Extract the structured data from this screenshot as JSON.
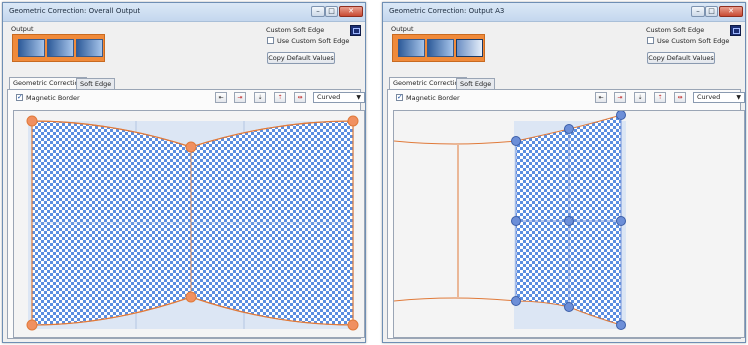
{
  "windows": [
    {
      "title": "Geometric Correction: Overall Output",
      "output_label": "Output",
      "custom_soft_edge_label": "Custom Soft Edge",
      "use_custom_soft_edge_label": "Use Custom Soft Edge",
      "copy_default_values_label": "Copy Default Values",
      "tabs": [
        "Geometric Correction",
        "Soft Edge"
      ],
      "magnetic_border_label": "Magnetic Border",
      "magnetic_border_checked": true,
      "mode_value": "Curved",
      "mode_arrow": "▼",
      "selected_output": null
    },
    {
      "title": "Geometric Correction: Output A3",
      "output_label": "Output",
      "custom_soft_edge_label": "Custom Soft Edge",
      "use_custom_soft_edge_label": "Use Custom Soft Edge",
      "copy_default_values_label": "Copy Default Values",
      "tabs": [
        "Geometric Correction",
        "Soft Edge"
      ],
      "magnetic_border_label": "Magnetic Border",
      "magnetic_border_checked": true,
      "mode_value": "Curved",
      "mode_arrow": "▼",
      "selected_output": 3
    }
  ],
  "controls": {
    "minimize": "–",
    "maximize": "□",
    "close": "✕"
  },
  "toolbar_icons": [
    "align-left-top-icon",
    "align-right-top-icon",
    "align-left-bottom-icon",
    "align-right-bottom-icon",
    "align-center-icon"
  ],
  "colors": {
    "grid_blue": "#5b8ee0",
    "curve_orange": "#e07a3a",
    "handle_orange": "#f09060",
    "handle_blue": "#6d8fd8"
  }
}
